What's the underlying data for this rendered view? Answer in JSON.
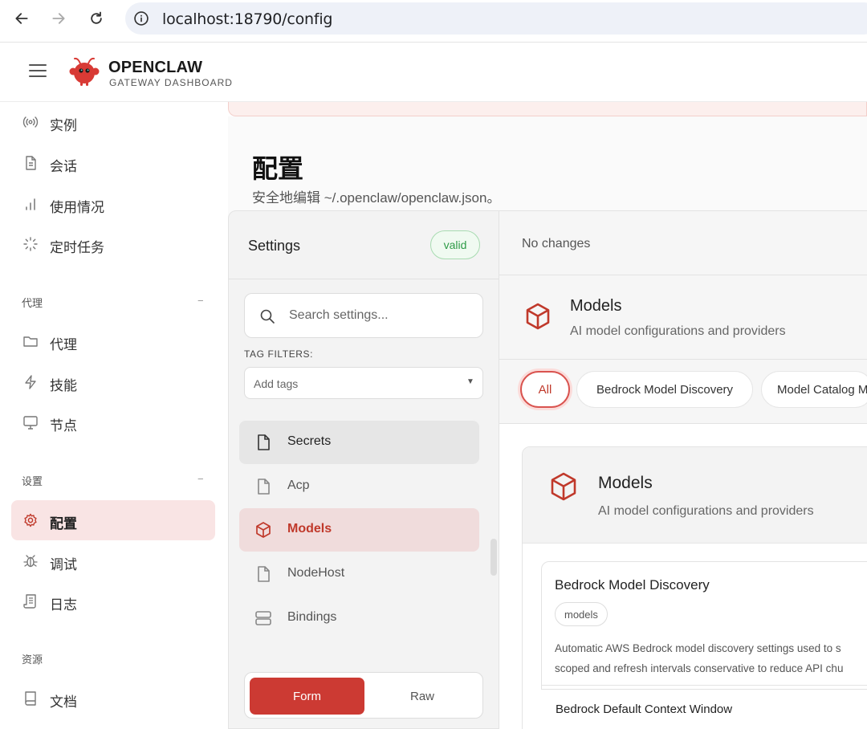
{
  "browser": {
    "url": "localhost:18790/config"
  },
  "app": {
    "brand_name": "OPENCLAW",
    "brand_sub": "GATEWAY DASHBOARD"
  },
  "sidebar": {
    "top_items": [
      {
        "label": "实例",
        "icon": "broadcast-icon"
      },
      {
        "label": "会话",
        "icon": "document-icon"
      },
      {
        "label": "使用情况",
        "icon": "bar-chart-icon"
      },
      {
        "label": "定时任务",
        "icon": "loader-icon"
      }
    ],
    "sections": [
      {
        "heading": "代理",
        "collapse": "−",
        "items": [
          {
            "label": "代理",
            "icon": "folder-icon"
          },
          {
            "label": "技能",
            "icon": "lightning-icon"
          },
          {
            "label": "节点",
            "icon": "monitor-icon"
          }
        ]
      },
      {
        "heading": "设置",
        "collapse": "−",
        "items": [
          {
            "label": "配置",
            "icon": "gear-icon",
            "active": true
          },
          {
            "label": "调试",
            "icon": "bug-icon"
          },
          {
            "label": "日志",
            "icon": "scroll-icon"
          }
        ]
      },
      {
        "heading": "资源",
        "items": [
          {
            "label": "文档",
            "icon": "book-icon"
          }
        ]
      }
    ]
  },
  "page": {
    "title": "配置",
    "subtitle": "安全地编辑 ~/.openclaw/openclaw.json。"
  },
  "settings": {
    "title": "Settings",
    "status": "valid",
    "search_placeholder": "Search settings...",
    "tag_filters_label": "TAG FILTERS:",
    "tag_placeholder": "Add tags",
    "sections": [
      {
        "label": "Secrets",
        "icon": "file-icon",
        "state": "hover"
      },
      {
        "label": "Acp",
        "icon": "file-icon"
      },
      {
        "label": "Models",
        "icon": "cube-icon",
        "state": "active"
      },
      {
        "label": "NodeHost",
        "icon": "file-icon"
      },
      {
        "label": "Bindings",
        "icon": "server-icon"
      }
    ],
    "mode": {
      "form": "Form",
      "raw": "Raw"
    }
  },
  "editor": {
    "status": "No changes",
    "section_title": "Models",
    "section_desc": "AI model configurations and providers",
    "chips": [
      "All",
      "Bedrock Model Discovery",
      "Model Catalog M"
    ],
    "card": {
      "title": "Models",
      "desc": "AI model configurations and providers",
      "fields": [
        {
          "title": "Bedrock Model Discovery",
          "tag": "models",
          "desc_line1": "Automatic AWS Bedrock model discovery settings used to s",
          "desc_line2": "scoped and refresh intervals conservative to reduce API chu"
        },
        {
          "title": "Bedrock Default Context Window"
        }
      ]
    }
  },
  "colors": {
    "accent": "#cc3a33",
    "active_bg": "#f9e4e4",
    "valid_green": "#2e9b47"
  }
}
